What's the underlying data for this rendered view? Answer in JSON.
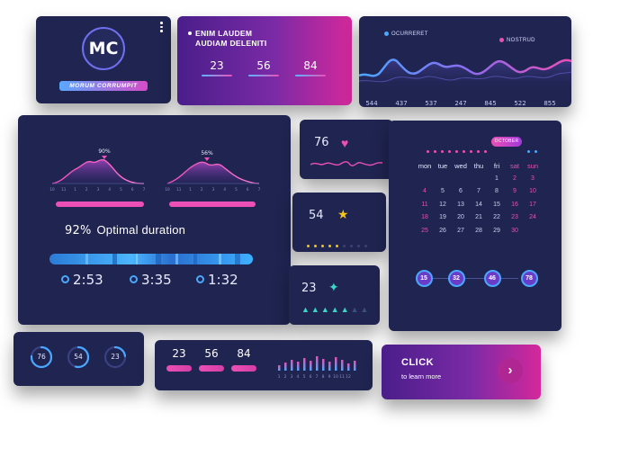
{
  "logo_card": {
    "initials": "MC",
    "ribbon": "MORUM CORRUMPIT"
  },
  "stats_top": {
    "title_line1": "ENIM LAUDEM",
    "title_line2": "AUDIAM DELENITI",
    "stats": [
      {
        "value": "23"
      },
      {
        "value": "56"
      },
      {
        "value": "84"
      }
    ]
  },
  "wave_card": {
    "legend": [
      {
        "label": "OCURRERET",
        "color": "#4aa8ff"
      },
      {
        "label": "NOSTRUD",
        "color": "#ec4fb6"
      }
    ],
    "numbers": [
      "544",
      "437",
      "537",
      "247",
      "845",
      "522",
      "855"
    ]
  },
  "big_card": {
    "axis_ticks": [
      "10",
      "11",
      "1",
      "2",
      "3",
      "4",
      "5",
      "6",
      "7"
    ],
    "peak_left": "90%",
    "peak_right": "56%",
    "percent": "92%",
    "title": "Optimal duration",
    "timers": [
      {
        "value": "2:53"
      },
      {
        "value": "3:35"
      },
      {
        "value": "1:32"
      }
    ]
  },
  "heart_card": {
    "value": "76",
    "icon": "heart-icon"
  },
  "star_card": {
    "value": "54",
    "icon": "star-icon",
    "filled_dots": 5,
    "total_dots": 9
  },
  "leaf_card": {
    "value": "23",
    "icon": "leaf-icon",
    "filled_trees": 5,
    "total_trees": 7
  },
  "calendar": {
    "month": "OCTOBER",
    "weekdays": [
      "mon",
      "tue",
      "wed",
      "thu",
      "fri",
      "sat",
      "sun"
    ],
    "weeks": [
      [
        "",
        "",
        "",
        "",
        "1",
        "2",
        "3"
      ],
      [
        "4",
        "5",
        "6",
        "7",
        "8",
        "9",
        "10"
      ],
      [
        "11",
        "12",
        "13",
        "14",
        "15",
        "16",
        "17"
      ],
      [
        "18",
        "19",
        "20",
        "21",
        "22",
        "23",
        "24"
      ],
      [
        "25",
        "26",
        "27",
        "28",
        "29",
        "30",
        ""
      ]
    ],
    "circles": [
      "15",
      "32",
      "46",
      "78"
    ]
  },
  "rings_card": {
    "rings": [
      {
        "value": "76",
        "progress": 0.76
      },
      {
        "value": "54",
        "progress": 0.54
      },
      {
        "value": "23",
        "progress": 0.23
      }
    ]
  },
  "bars_card": {
    "stats": [
      "23",
      "56",
      "84"
    ],
    "bar_heights": [
      6,
      9,
      12,
      10,
      14,
      11,
      16,
      13,
      10,
      15,
      12,
      8,
      11
    ],
    "bar_labels": [
      "1",
      "2",
      "3",
      "4",
      "5",
      "6",
      "7",
      "8",
      "9",
      "10",
      "11",
      "12"
    ]
  },
  "click_card": {
    "title": "CLICK",
    "subtitle": "to learn more",
    "arrow_icon": "chevron-right-icon"
  },
  "colors": {
    "card_bg": "#1f2450",
    "accent_pink": "#ec4fb6",
    "accent_blue": "#4aa8ff",
    "accent_teal": "#3ad6c6",
    "star_yellow": "#f5c518"
  }
}
